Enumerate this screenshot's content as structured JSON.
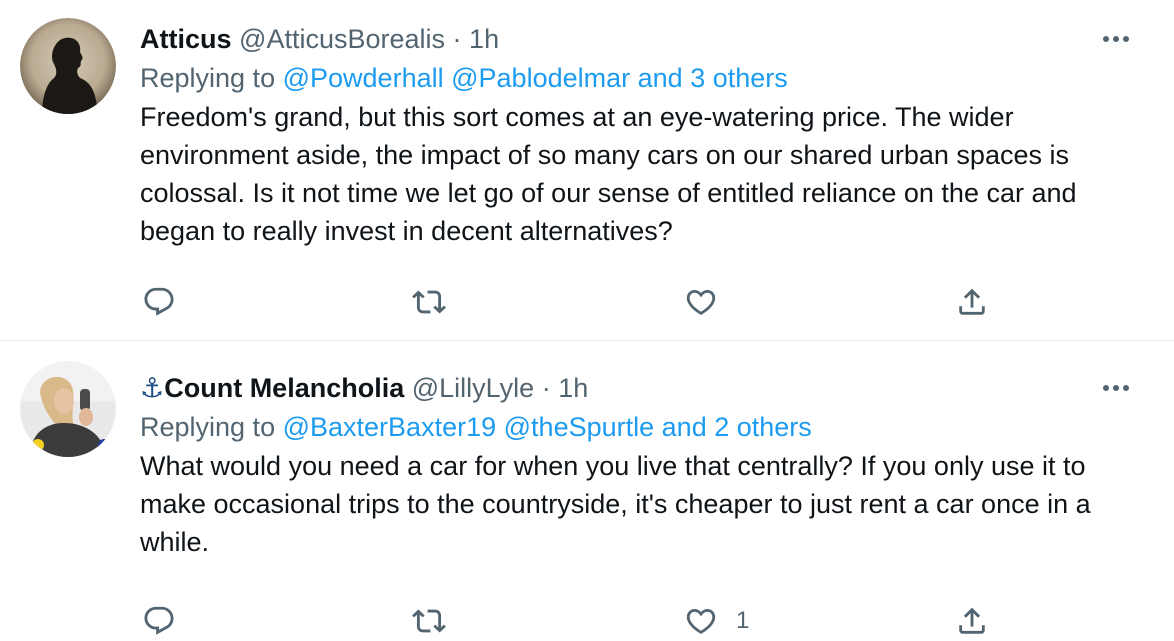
{
  "tweets": [
    {
      "name": "Atticus",
      "handle": "@AtticusBorealis",
      "separator": "·",
      "time": "1h",
      "replying_prefix": "Replying to",
      "replying_to": [
        "@Powderhall",
        "@Pablodelmar"
      ],
      "replying_others": "and 3 others",
      "text": "Freedom's grand, but this sort comes at an eye-watering price.  The wider environment aside, the impact of so many cars on our shared urban spaces is colossal. Is it not time we let go of our sense of entitled reliance on the car and began to really invest in decent alternatives?",
      "like_count": ""
    },
    {
      "name_emoji": "⚓",
      "name": "Count Melancholia",
      "handle": "@LillyLyle",
      "separator": "·",
      "time": "1h",
      "replying_prefix": "Replying to",
      "replying_to": [
        "@BaxterBaxter19",
        "@theSpurtle"
      ],
      "replying_others": "and 2 others",
      "text": "What would you need a car for when you live that centrally? If you only use it to make occasional trips to the countryside, it's cheaper to just rent a car once in a while.",
      "like_count": "1"
    }
  ],
  "icons": {
    "reply": "reply-icon",
    "retweet": "retweet-icon",
    "like": "heart-icon",
    "share": "share-icon",
    "more": "more-icon"
  },
  "colors": {
    "link": "#1d9bf0",
    "secondary": "#536471",
    "text": "#0f1419",
    "divider": "#e6ecf0"
  }
}
